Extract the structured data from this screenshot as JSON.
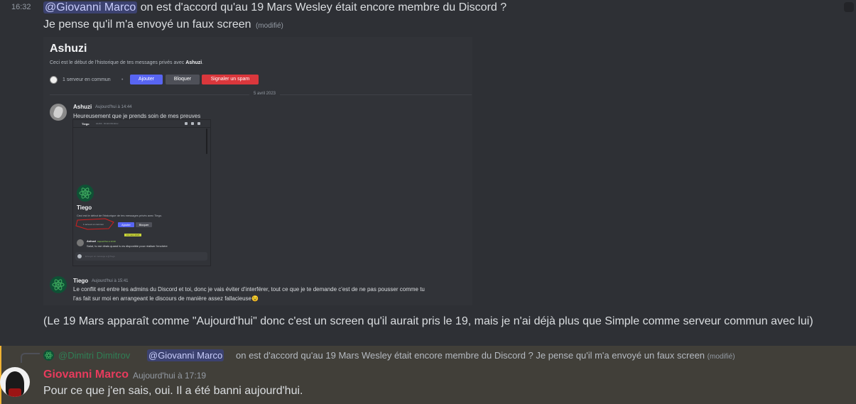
{
  "message1": {
    "timestamp": "16:32",
    "mention": "@Giovanni Marco",
    "line1_rest": " on est d'accord qu'au 19 Mars Wesley était encore membre du Discord ?",
    "line2": "Je pense qu'il m'a envoyé un faux screen",
    "edited": "(modifié)",
    "caption": "(Le 19 Mars apparaît comme \"Aujourd'hui\" donc c'est un screen qu'il aurait pris le 19, mais je n'ai déjà plus que Simple comme serveur commun avec lui)"
  },
  "screenshot": {
    "title": "Ashuzi",
    "subtitle_prefix": "Ceci est le début de l'historique de tes messages privés avec ",
    "subtitle_name": "Ashuzi",
    "subtitle_suffix": ".",
    "server_common": "1 serveur en commun",
    "dot": "•",
    "add_button": "Ajouter",
    "block_button": "Bloquer",
    "spam_button": "Signaler un spam",
    "date_separator": "5 avril 2023",
    "msg_ashuzi": {
      "name": "Ashuzi",
      "time": "Aujourd'hui à 14:44",
      "text": "Heureusement que je prends soin de mes preuves"
    },
    "msg_tiego": {
      "name": "Tiego",
      "time": "Aujourd'hui à 15:41",
      "text_line1": "Le conflit est entre les admins du Discord et toi, donc je vais éviter d'interférer, tout ce que je te demande c'est de ne pas pousser comme tu",
      "text_line2": "l'as fait sur moi en arrangeant le discours de manière assez fallacieuse",
      "emoji": "😉"
    }
  },
  "inner_screenshot": {
    "header_name": "Tiego",
    "header_call": "ALIAS · Dimitri Dimitrov",
    "title": "Tiego",
    "subtitle": "Ceci est le début de l'historique de tes messages privés avec Tiego.",
    "server_common": "1 serveur en commun",
    "add_button": "Ajouter",
    "block_button": "Bloquer",
    "date": "19 mars 2023",
    "msg_name": "Ashuzi",
    "msg_time": "Aujourd'hui à 13:40",
    "msg_text_line1": "Salut, tu me dirais quand tu es disponible pour réaliser l'enchère",
    "input_placeholder": "Envoyer un message à @Tiego"
  },
  "message2": {
    "reply_author": "@Dimitri Dimitrov",
    "reply_mention": "@Giovanni Marco",
    "reply_text": " on est d'accord qu'au 19 Mars Wesley était encore membre du Discord ? Je pense qu'il m'a envoyé un faux screen",
    "reply_edited": "(modifié)",
    "author": "Giovanni Marco",
    "timestamp": "Aujourd'hui à 17:19",
    "text": "Pour ce que j'en sais, oui. Il a été banni aujourd'hui."
  },
  "colors": {
    "background": "#313338",
    "mention_bg": "#3c4270",
    "highlight_bg": "#413f39",
    "author_color": "#e83b5d",
    "blurple": "#5865f2",
    "danger": "#da373c"
  }
}
